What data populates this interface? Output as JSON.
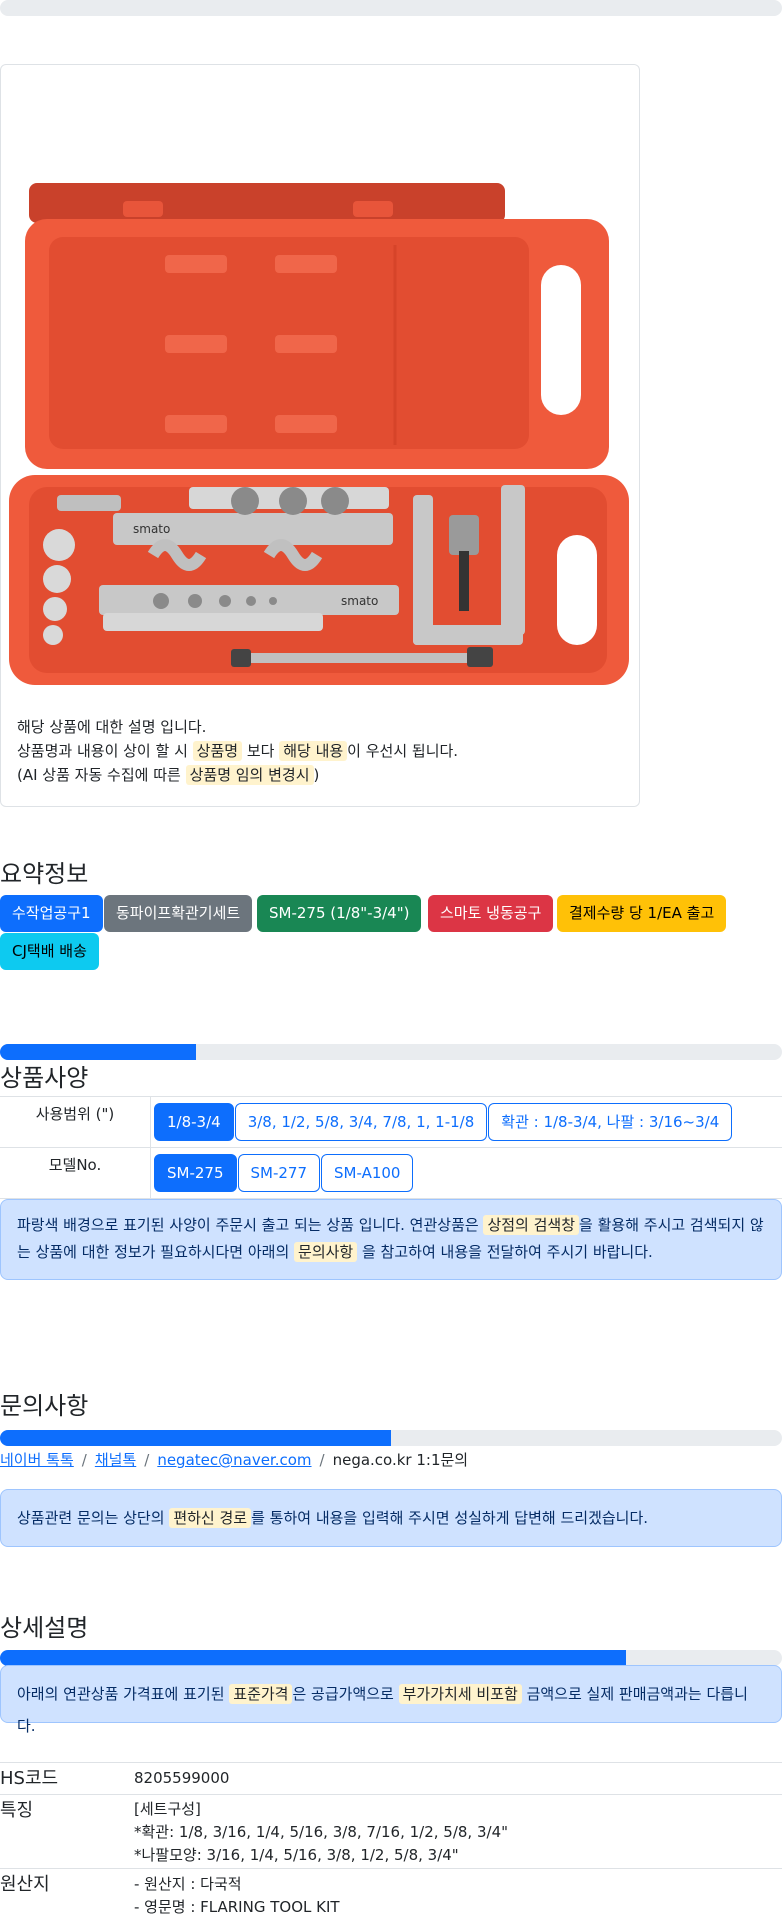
{
  "product": {
    "image_alt": "smato flaring tool kit",
    "brand_mark": "smato",
    "desc_line1": "해당 상품에 대한 설명 입니다.",
    "desc_line2": {
      "a": "상품명과 내용이 상이 할 시 ",
      "h1": "상품명",
      "b": " 보다 ",
      "h2": "해당 내용",
      "c": "이 우선시 됩니다."
    },
    "desc_line3": {
      "a": "(AI 상품 자동 수집에 따른 ",
      "h1": "상품명 임의 변경시",
      "b": ")"
    }
  },
  "summary": {
    "title": "요약정보",
    "badges": [
      {
        "label": "수작업공구1",
        "bg": "#0d6efd",
        "fg": "#ffffff"
      },
      {
        "label": "동파이프확관기세트",
        "bg": "#6c757d",
        "fg": "#ffffff"
      },
      {
        "label": "SM-275 (1/8\"-3/4\")",
        "bg": "#198754",
        "fg": "#ffffff"
      },
      {
        "label": "스마토 냉동공구",
        "bg": "#dc3545",
        "fg": "#ffffff"
      },
      {
        "label": "결제수량 당 1/EA 출고",
        "bg": "#ffc107",
        "fg": "#000000"
      },
      {
        "label": "CJ택배 배송",
        "bg": "#0dcaf0",
        "fg": "#000000"
      }
    ]
  },
  "specs": {
    "progress_pct": 25,
    "title": "상품사양",
    "rows": [
      {
        "label": "사용범위 (\")",
        "options": [
          "1/8-3/4",
          "3/8, 1/2, 5/8, 3/4, 7/8, 1, 1-1/8",
          "확관 : 1/8-3/4, 나팔 : 3/16~3/4"
        ],
        "active": 0
      },
      {
        "label": "모델No.",
        "options": [
          "SM-275",
          "SM-277",
          "SM-A100"
        ],
        "active": 0
      }
    ],
    "notice": {
      "a": "파랑색 배경으로 표기된 사양이 주문시 출고 되는 상품 입니다. 연관상품은 ",
      "h1": "상점의 검색창",
      "b": "을 활용해 주시고 검색되지 않는 상품에 대한 정보가 필요하시다면 아래의 ",
      "h2": "문의사항",
      "c": " 을 참고하여 내용을 전달하여 주시기 바랍니다."
    }
  },
  "inquiry": {
    "title": "문의사항",
    "progress_pct": 50,
    "links": [
      "네이버 톡톡",
      "채널톡",
      "negatec@naver.com"
    ],
    "plain": "nega.co.kr 1:1문의",
    "notice": {
      "a": "상품관련 문의는 상단의 ",
      "h1": "편하신 경로",
      "b": "를 통하여 내용을 입력해 주시면 성실하게 답변해 드리겠습니다."
    }
  },
  "detail": {
    "title": "상세설명",
    "progress_pct": 80,
    "notice": {
      "a": "아래의 연관상품 가격표에 표기된 ",
      "h1": "표준가격",
      "b": "은 공급가액으로 ",
      "h2": "부가가치세 비포함",
      "c": " 금액으로 실제 판매금액과는 다릅니다."
    },
    "rows": [
      {
        "label": "HS코드",
        "lines": [
          "8205599000"
        ]
      },
      {
        "label": "특징",
        "lines": [
          "[세트구성]",
          "*확관: 1/8, 3/16, 1/4, 5/16, 3/8, 7/16, 1/2, 5/8, 3/4\"",
          "*나팔모양: 3/16, 1/4, 5/16, 3/8, 1/2, 5/8, 3/4\""
        ]
      },
      {
        "label": "원산지",
        "lines": [
          "- 원산지 : 다국적",
          "- 영문명 : FLARING TOOL KIT"
        ]
      }
    ]
  }
}
